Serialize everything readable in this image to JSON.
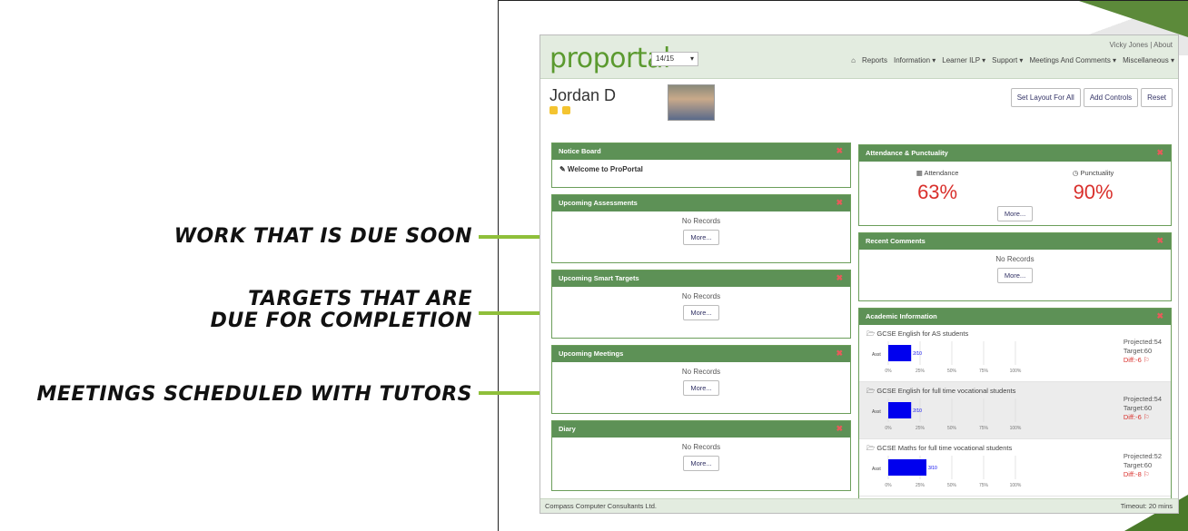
{
  "annotations": [
    "WORK THAT IS DUE SOON",
    "TARGETS THAT ARE",
    "DUE FOR COMPLETION",
    "MEETINGS SCHEDULED WITH TUTORS"
  ],
  "app": {
    "logo": "proportal",
    "year": "14/15",
    "user": "Vicky Jones  |  About",
    "nav": [
      "Reports",
      "Information ▾",
      "Learner ILP ▾",
      "Support ▾",
      "Meetings And Comments ▾",
      "Miscellaneous ▾"
    ]
  },
  "learner": {
    "name": "Jordan D"
  },
  "buttons": {
    "layout": "Set Layout For All",
    "controls": "Add Controls",
    "reset": "Reset"
  },
  "panels": {
    "notice": {
      "title": "Notice Board",
      "welcome": "✎ Welcome to ProPortal"
    },
    "assess": {
      "title": "Upcoming Assessments",
      "body": "No Records",
      "more": "More..."
    },
    "targets": {
      "title": "Upcoming Smart Targets",
      "body": "No Records",
      "more": "More..."
    },
    "meetings": {
      "title": "Upcoming Meetings",
      "body": "No Records",
      "more": "More..."
    },
    "diary": {
      "title": "Diary",
      "body": "No Records",
      "more": "More..."
    },
    "attendance": {
      "title": "Attendance & Punctuality",
      "att_label": "▦ Attendance",
      "att_value": "63%",
      "punct_label": "◷ Punctuality",
      "punct_value": "90%",
      "more": "More..."
    },
    "comments": {
      "title": "Recent Comments",
      "body": "No Records",
      "more": "More..."
    },
    "academic": {
      "title": "Academic Information",
      "items": [
        {
          "title": "GCSE English for AS students",
          "projected": "Projected:54",
          "target": "Target:60",
          "diff": "Diff:-6 ⚐"
        },
        {
          "title": "GCSE English for full time vocational students",
          "projected": "Projected:54",
          "target": "Target:60",
          "diff": "Diff:-6 ⚐"
        },
        {
          "title": "GCSE Maths for full time vocational students",
          "projected": "Projected:52",
          "target": "Target:60",
          "diff": "Diff:-8 ⚐"
        }
      ],
      "axis": [
        "0%",
        "25%",
        "50%",
        "75%",
        "100%"
      ],
      "bar_label": "Asst",
      "bar_fracs": [
        0.18,
        0.18,
        0.3
      ],
      "bar_texts": [
        "2/10",
        "2/10",
        "3/10"
      ]
    }
  },
  "footer": {
    "left": "Compass Computer Consultants Ltd.",
    "right": "Timeout: 20 mins"
  },
  "colors": {
    "accent": "#5d9156",
    "arrow": "#8fbf3a",
    "alert": "#d9302c"
  }
}
